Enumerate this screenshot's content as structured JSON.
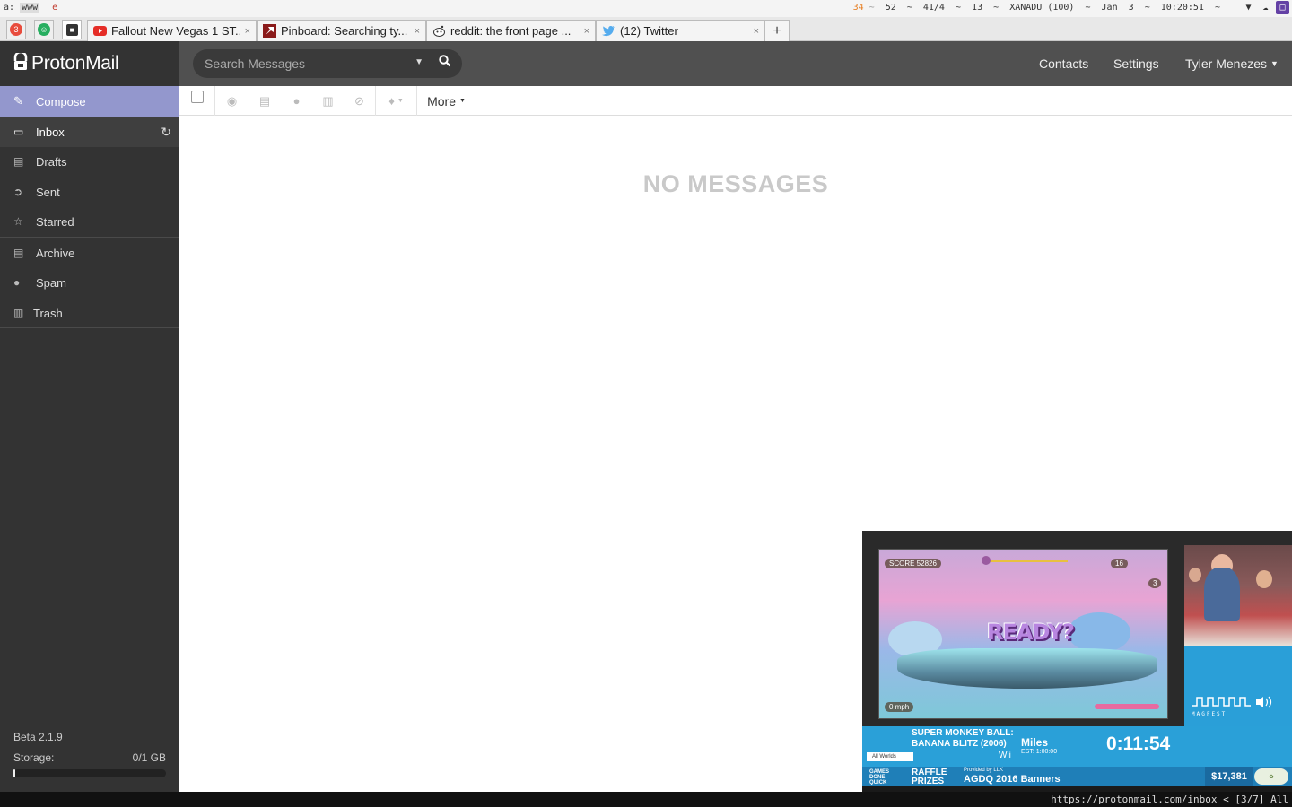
{
  "statusbar": {
    "workspace_label": "a:",
    "workspace_active": "www",
    "workspace_e": "e",
    "stat_orange": "34",
    "stats_rest": "52  ~  41/4  ~  13  ~  XANADU (100)  ~  Jan  3  ~  10:20:51  ~",
    "sep": "~"
  },
  "tabs": {
    "pinned_1_badge": "3",
    "pinned_2_badge": "☺",
    "items": [
      {
        "title": "Fallout New Vegas 1 ST...",
        "close": "×"
      },
      {
        "title": "Pinboard: Searching ty...",
        "close": "×"
      },
      {
        "title": "reddit: the front page ...",
        "close": "×"
      },
      {
        "title": "(12) Twitter",
        "close": "×"
      }
    ],
    "new_tab": "+"
  },
  "header": {
    "logo": "ProtonMail",
    "search_placeholder": "Search Messages",
    "contacts": "Contacts",
    "settings": "Settings",
    "user": "Tyler Menezes"
  },
  "sidebar": {
    "compose": "Compose",
    "items": [
      {
        "label": "Inbox"
      },
      {
        "label": "Drafts"
      },
      {
        "label": "Sent"
      },
      {
        "label": "Starred"
      },
      {
        "label": "Archive"
      },
      {
        "label": "Spam"
      },
      {
        "label": "Trash"
      }
    ],
    "version": "Beta 2.1.9",
    "storage_label": "Storage:",
    "storage_value": "0/1 GB",
    "storage_fraction": 0.01
  },
  "toolbar": {
    "more_label": "More"
  },
  "main": {
    "empty_text": "NO MESSAGES"
  },
  "stream": {
    "ready_text": "READY?",
    "hud_score": "SCORE  52826",
    "hud_bananas": "16",
    "hud_lives": "3",
    "hud_speed": "0 mph",
    "game_title_1": "SUPER MONKEY BALL:",
    "game_title_2": "BANANA BLITZ (2006)",
    "platform": "Wii",
    "category": "All Worlds",
    "runner": "Miles",
    "estimate": "EST: 1:00:00",
    "timer": "0:11:54",
    "gdq_1": "GAMES",
    "gdq_2": "DONE",
    "gdq_3": "QUICK",
    "raffle_1": "RAFFLE",
    "raffle_2": "PRIZES",
    "provided": "Provided by LLK",
    "ticker": "AGDQ 2016 Banners",
    "total": "$17,381",
    "magfest": "MAGFEST"
  },
  "bottombar": {
    "url": "https://protonmail.com/inbox < [3/7] All"
  },
  "colors": {
    "compose_bg": "#9397cd",
    "sidebar_bg": "#333333",
    "header_bg": "#505050",
    "empty_text": "#c9c9c9"
  }
}
